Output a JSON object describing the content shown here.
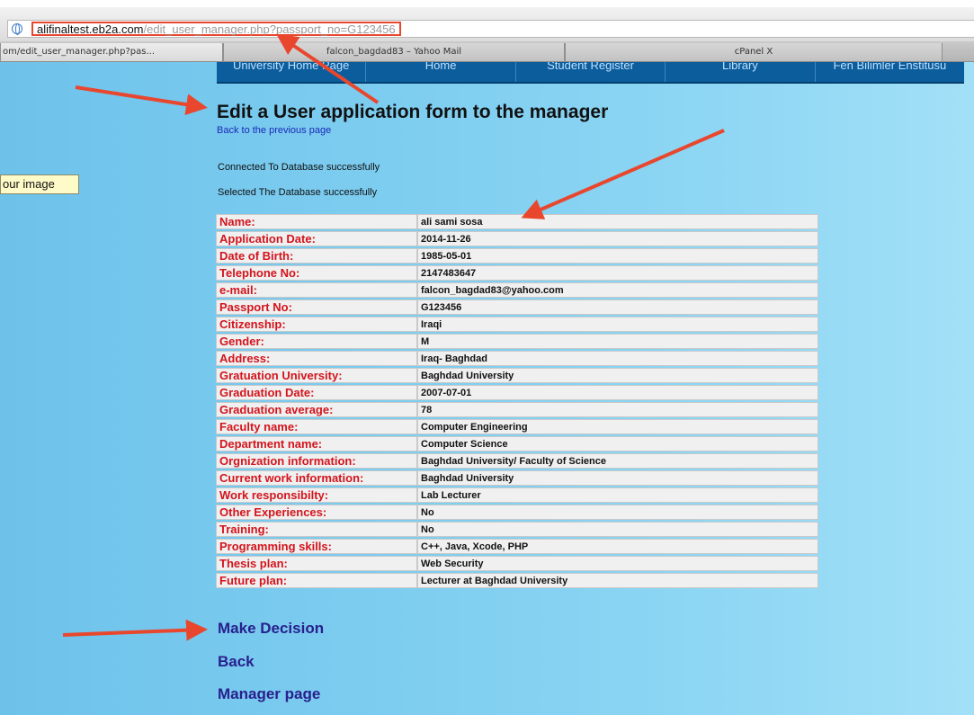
{
  "browser": {
    "url_host": "alifinaltest.eb2a.com",
    "url_path": "/edit_user_manager.php?passport_no=G123456",
    "tabs": [
      {
        "label": "om/edit_user_manager.php?pas..."
      },
      {
        "label": "falcon_bagdad83 – Yahoo Mail"
      },
      {
        "label": "cPanel X"
      }
    ]
  },
  "nav": {
    "items": [
      "University Home Page",
      "Home",
      "Student Register",
      "Library",
      "Fen Bilimler Enstitusu"
    ]
  },
  "page": {
    "title": "Edit a User application form to the manager",
    "back_link": "Back to the previous page",
    "status_messages": [
      "Connected To Database successfully",
      "Selected The Database successfully"
    ],
    "tooltip": "our image"
  },
  "form_rows": [
    {
      "label": "Name:",
      "value": "ali sami sosa"
    },
    {
      "label": "Application Date:",
      "value": "2014-11-26"
    },
    {
      "label": "Date of Birth:",
      "value": "1985-05-01"
    },
    {
      "label": "Telephone No:",
      "value": "2147483647"
    },
    {
      "label": "e-mail:",
      "value": "falcon_bagdad83@yahoo.com"
    },
    {
      "label": "Passport No:",
      "value": "G123456"
    },
    {
      "label": "Citizenship:",
      "value": "Iraqi"
    },
    {
      "label": "Gender:",
      "value": "M"
    },
    {
      "label": "Address:",
      "value": "Iraq- Baghdad"
    },
    {
      "label": "Gratuation University:",
      "value": "Baghdad University"
    },
    {
      "label": "Graduation Date:",
      "value": "2007-07-01"
    },
    {
      "label": "Graduation average:",
      "value": "78"
    },
    {
      "label": "Faculty name:",
      "value": "Computer Engineering"
    },
    {
      "label": "Department name:",
      "value": "Computer Science"
    },
    {
      "label": "Orgnization information:",
      "value": "Baghdad University/ Faculty of Science"
    },
    {
      "label": "Current work information:",
      "value": "Baghdad University"
    },
    {
      "label": "Work responsibilty:",
      "value": "Lab Lecturer"
    },
    {
      "label": "Other Experiences:",
      "value": "No"
    },
    {
      "label": "Training:",
      "value": "No"
    },
    {
      "label": "Programming skills:",
      "value": "C++, Java, Xcode, PHP"
    },
    {
      "label": "Thesis plan:",
      "value": "Web Security"
    },
    {
      "label": "Future plan:",
      "value": "Lecturer at Baghdad University"
    }
  ],
  "actions": {
    "make_decision": "Make Decision",
    "back": "Back",
    "manager_page": "Manager page"
  },
  "colors": {
    "label_red": "#d4141c",
    "link_blue": "#28208d",
    "annotation_arrow": "#e8472e",
    "nav_bg": "#0b5d9c"
  }
}
